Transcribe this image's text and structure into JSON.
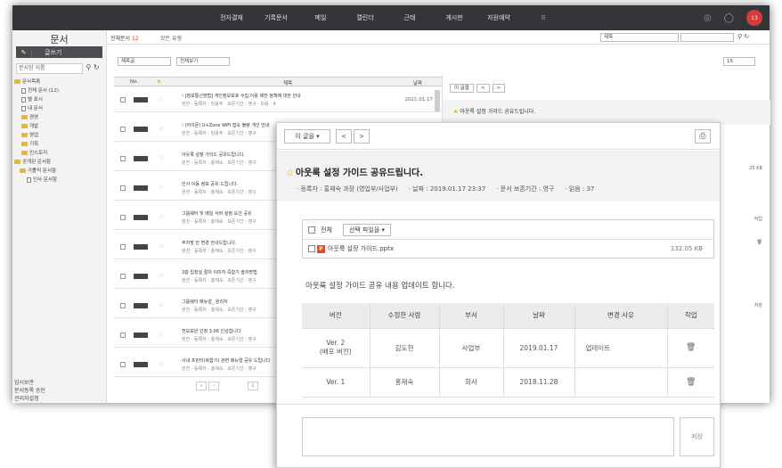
{
  "topnav": [
    "전자결재",
    "기록문서",
    "메일",
    "캘린더",
    "근태",
    "게시판",
    "자원예약"
  ],
  "notification_count": "13",
  "sidebar": {
    "title": "문서",
    "write_label": "글쓰기",
    "search_placeholder": "문서함 이름",
    "tree": [
      {
        "label": "문서목록",
        "type": "folder"
      },
      {
        "label": "전체 문서 (12)",
        "type": "doc"
      },
      {
        "label": "별 표시",
        "type": "doc"
      },
      {
        "label": "내 문서",
        "type": "doc"
      },
      {
        "label": "경영",
        "type": "folder"
      },
      {
        "label": "개발",
        "type": "folder"
      },
      {
        "label": "영업",
        "type": "folder"
      },
      {
        "label": "기획",
        "type": "folder"
      },
      {
        "label": "인스토리",
        "type": "folder"
      },
      {
        "label": "공개된 문서함",
        "type": "folder"
      },
      {
        "label": "가톨릭 문서함",
        "type": "folder"
      },
      {
        "label": "인사 문서함",
        "type": "doc"
      }
    ],
    "bottom": [
      "임시보관",
      "문서등록 승인",
      "관리자설정"
    ]
  },
  "list": {
    "count_label": "전체문서",
    "count": "12",
    "filter": "모든 유형",
    "dd1": "제목글",
    "dd2": "전체보기",
    "col_no": "No.",
    "col_title": "제목",
    "col_date": "날짜",
    "rows": [
      {
        "t1": "[정보통신망법] 개인정보보호 수집,이용 제한 정책에 대한 안내",
        "t2": "원천 · 등록자 : 임용주 · 보존기간 : 영구 · 읽음 : 4",
        "date": "2021.01.17",
        "mark": "!"
      },
      {
        "t1": "(아이온) U+Zone WiFi 접속 불량 개선 안내",
        "t2": "원천 · 등록자 : 임용주 · 보존기간 : 영구",
        "date": "",
        "mark": "!"
      },
      {
        "t1": "아웃룩 설정 가이드 공유드립니다.",
        "t2": "원천 · 등록자 : 총재숙 · 보존기간 : 영구",
        "date": "",
        "mark": ""
      },
      {
        "t1": "인사 이동 정보 공유 드립니다.",
        "t2": "원천 · 등록자 : 총재숙 · 보존기간 : 영구",
        "date": "",
        "mark": ""
      },
      {
        "t1": "그룹웨어 및 메일 서버 설정 요건 공유",
        "t2": "원천 · 등록자 : 총재숙 · 보존기간 : 영구",
        "date": "",
        "mark": ""
      },
      {
        "t1": "주차장 안 변경 안내드립니다.",
        "t2": "원천 · 등록자 : 총재숙 · 보존기간 : 영구",
        "date": "",
        "mark": ""
      },
      {
        "t1": "3층 입장실 절차 이미지 즉합기 솔저방법",
        "t2": "원천 · 등록자 : 총재숙 · 보존기간 : 영구",
        "date": "",
        "mark": ""
      },
      {
        "t1": "그룹웨어 매뉴얼_ 윈리자",
        "t2": "원천 · 등록자 : 총재숙 · 보존기간 : 영구",
        "date": "",
        "mark": ""
      },
      {
        "t1": "전보보완 인정 3.06 인상합니다",
        "t2": "원천 · 등록자 : 총재숙 · 보존기간 : 영구",
        "date": "",
        "mark": ""
      },
      {
        "t1": "사내 프린터(복합기) 관련 매뉴얼 공유 드립니다",
        "t2": "원천 · 등록자 : 총재숙 · 보존기간 : 영구",
        "date": "",
        "mark": ""
      }
    ],
    "page": "1"
  },
  "right": {
    "top_search": "제목",
    "per_page": "15",
    "nav_label": "이 글을",
    "title": "아웃룩 설정 가이드 공유드립니다.",
    "side_size": "25 KB",
    "side_action": "작업",
    "side_save": "저장"
  },
  "modal": {
    "nav_label": "이 글을",
    "prev": "<",
    "next": ">",
    "title": "아웃룩 설정 가이드 공유드립니다.",
    "meta": [
      "· 등록자 : 홍재숙 과장 (영업부/사업부)",
      "· 날짜 : 2019.01.17 23:37",
      "· 문서 보존기간 : 영구",
      "· 읽음 : 37"
    ],
    "file_all": "전체",
    "file_select": "선택 파일을",
    "file_name": "아웃룩 설정 가이드.pptx",
    "file_size": "132.05 KB",
    "content": "아웃룩 설정 가이드 공유 내용 업데이트 합니다.",
    "table_headers": [
      "버전",
      "수정한 사람",
      "부서",
      "날짜",
      "변경 사유",
      "작업"
    ],
    "table_rows": [
      {
        "version": "Ver. 2",
        "version_sub": "(배포 버전)",
        "editor": "김도현",
        "dept": "사업부",
        "date": "2019.01.17",
        "reason": "업데이트"
      },
      {
        "version": "Ver. 1",
        "version_sub": "",
        "editor": "홍재숙",
        "dept": "회사",
        "date": "2018.11.28",
        "reason": ""
      }
    ],
    "save_label": "저장"
  }
}
